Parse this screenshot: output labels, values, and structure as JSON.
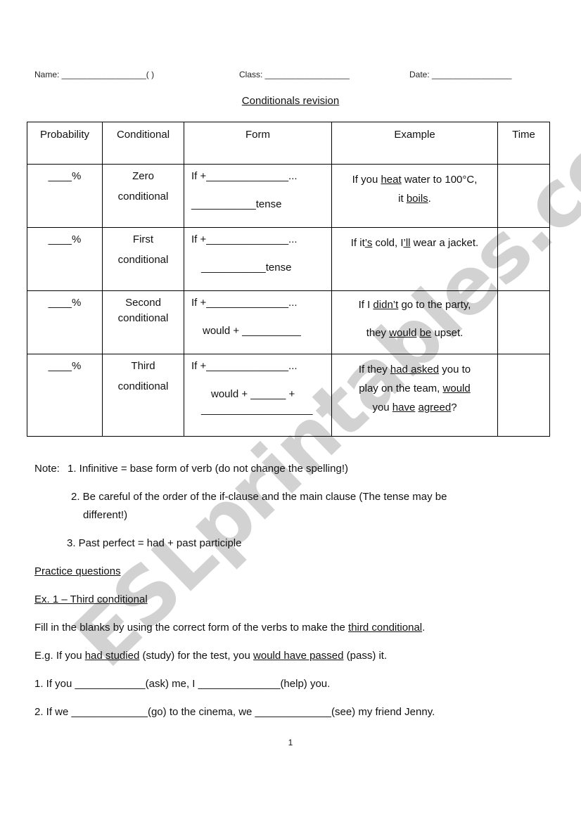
{
  "header": {
    "name_label": "Name: __________________(        )",
    "class_label": "Class: __________________",
    "date_label": "Date: _________________"
  },
  "title": "Conditionals revision",
  "table": {
    "columns": [
      "Probability",
      "Conditional",
      "Form",
      "Example",
      "Time"
    ],
    "rows": [
      {
        "probability": "____%",
        "conditional_line1": "Zero",
        "conditional_line2": "conditional",
        "form_line1": "If +______________...",
        "form_line2": "___________tense",
        "example": [
          {
            "t": "If you "
          },
          {
            "t": "heat",
            "u": true
          },
          {
            "t": " water to 100°C,"
          },
          {
            "br": true
          },
          {
            "t": "it "
          },
          {
            "t": "boils",
            "u": true
          },
          {
            "t": "."
          }
        ],
        "time": ""
      },
      {
        "probability": "____%",
        "conditional_line1": "First",
        "conditional_line2": "conditional",
        "form_line1": "If +______________...",
        "form_line2": "___________tense",
        "example": [
          {
            "t": "If it"
          },
          {
            "t": "’s",
            "u": true
          },
          {
            "t": " cold, I"
          },
          {
            "t": "’ll",
            "u": true
          },
          {
            "t": " wear a jacket."
          }
        ],
        "time": ""
      },
      {
        "probability": "____%",
        "conditional_line1": "Second",
        "conditional_line2": "conditional",
        "form_line1": "If +______________...",
        "form_line2": "would + __________",
        "example": [
          {
            "t": "If I "
          },
          {
            "t": "didn’t",
            "u": true
          },
          {
            "t": " go to the party,"
          },
          {
            "br": true
          },
          {
            "t": "they "
          },
          {
            "t": "would",
            "u": true
          },
          {
            "t": " "
          },
          {
            "t": "be",
            "u": true
          },
          {
            "t": " upset."
          }
        ],
        "time": ""
      },
      {
        "probability": "____%",
        "conditional_line1": "Third",
        "conditional_line2": "conditional",
        "form_line1": "If +______________...",
        "form_line2": "would + ______ +",
        "form_line3": "___________________",
        "example": [
          {
            "t": "If they "
          },
          {
            "t": "had asked",
            "u": true
          },
          {
            "t": " you to"
          },
          {
            "br": true
          },
          {
            "t": "play on the team, "
          },
          {
            "t": "would",
            "u": true
          },
          {
            "br": true
          },
          {
            "t": "you "
          },
          {
            "t": "have",
            "u": true
          },
          {
            "t": " "
          },
          {
            "t": "agreed",
            "u": true
          },
          {
            "t": "?"
          }
        ],
        "time": ""
      }
    ]
  },
  "notes": {
    "label": "Note:",
    "item1": "1. Infinitive = base form of verb (do not change the spelling!)",
    "item2a": "2. Be careful of the order of the if-clause and the main clause (The tense may be",
    "item2b": "different!)",
    "item3": "3. Past perfect = had + past participle"
  },
  "practice": {
    "heading": "Practice questions",
    "exercise_title": "Ex. 1 – Third conditional",
    "instruction_pre": "Fill in the blanks by using the correct form of the verbs to make the ",
    "instruction_u": "third conditional",
    "instruction_post": ".",
    "example": [
      {
        "t": "E.g. If you "
      },
      {
        "t": "had studied",
        "u": true
      },
      {
        "t": " (study) for the test, you "
      },
      {
        "t": "would have passed",
        "u": true
      },
      {
        "t": " (pass) it."
      }
    ],
    "q1": "1. If you ____________(ask) me, I ______________(help) you.",
    "q2": "2. If we _____________(go) to the cinema, we _____________(see) my friend Jenny."
  },
  "page_number": "1",
  "watermark": "ESLprintables.com"
}
